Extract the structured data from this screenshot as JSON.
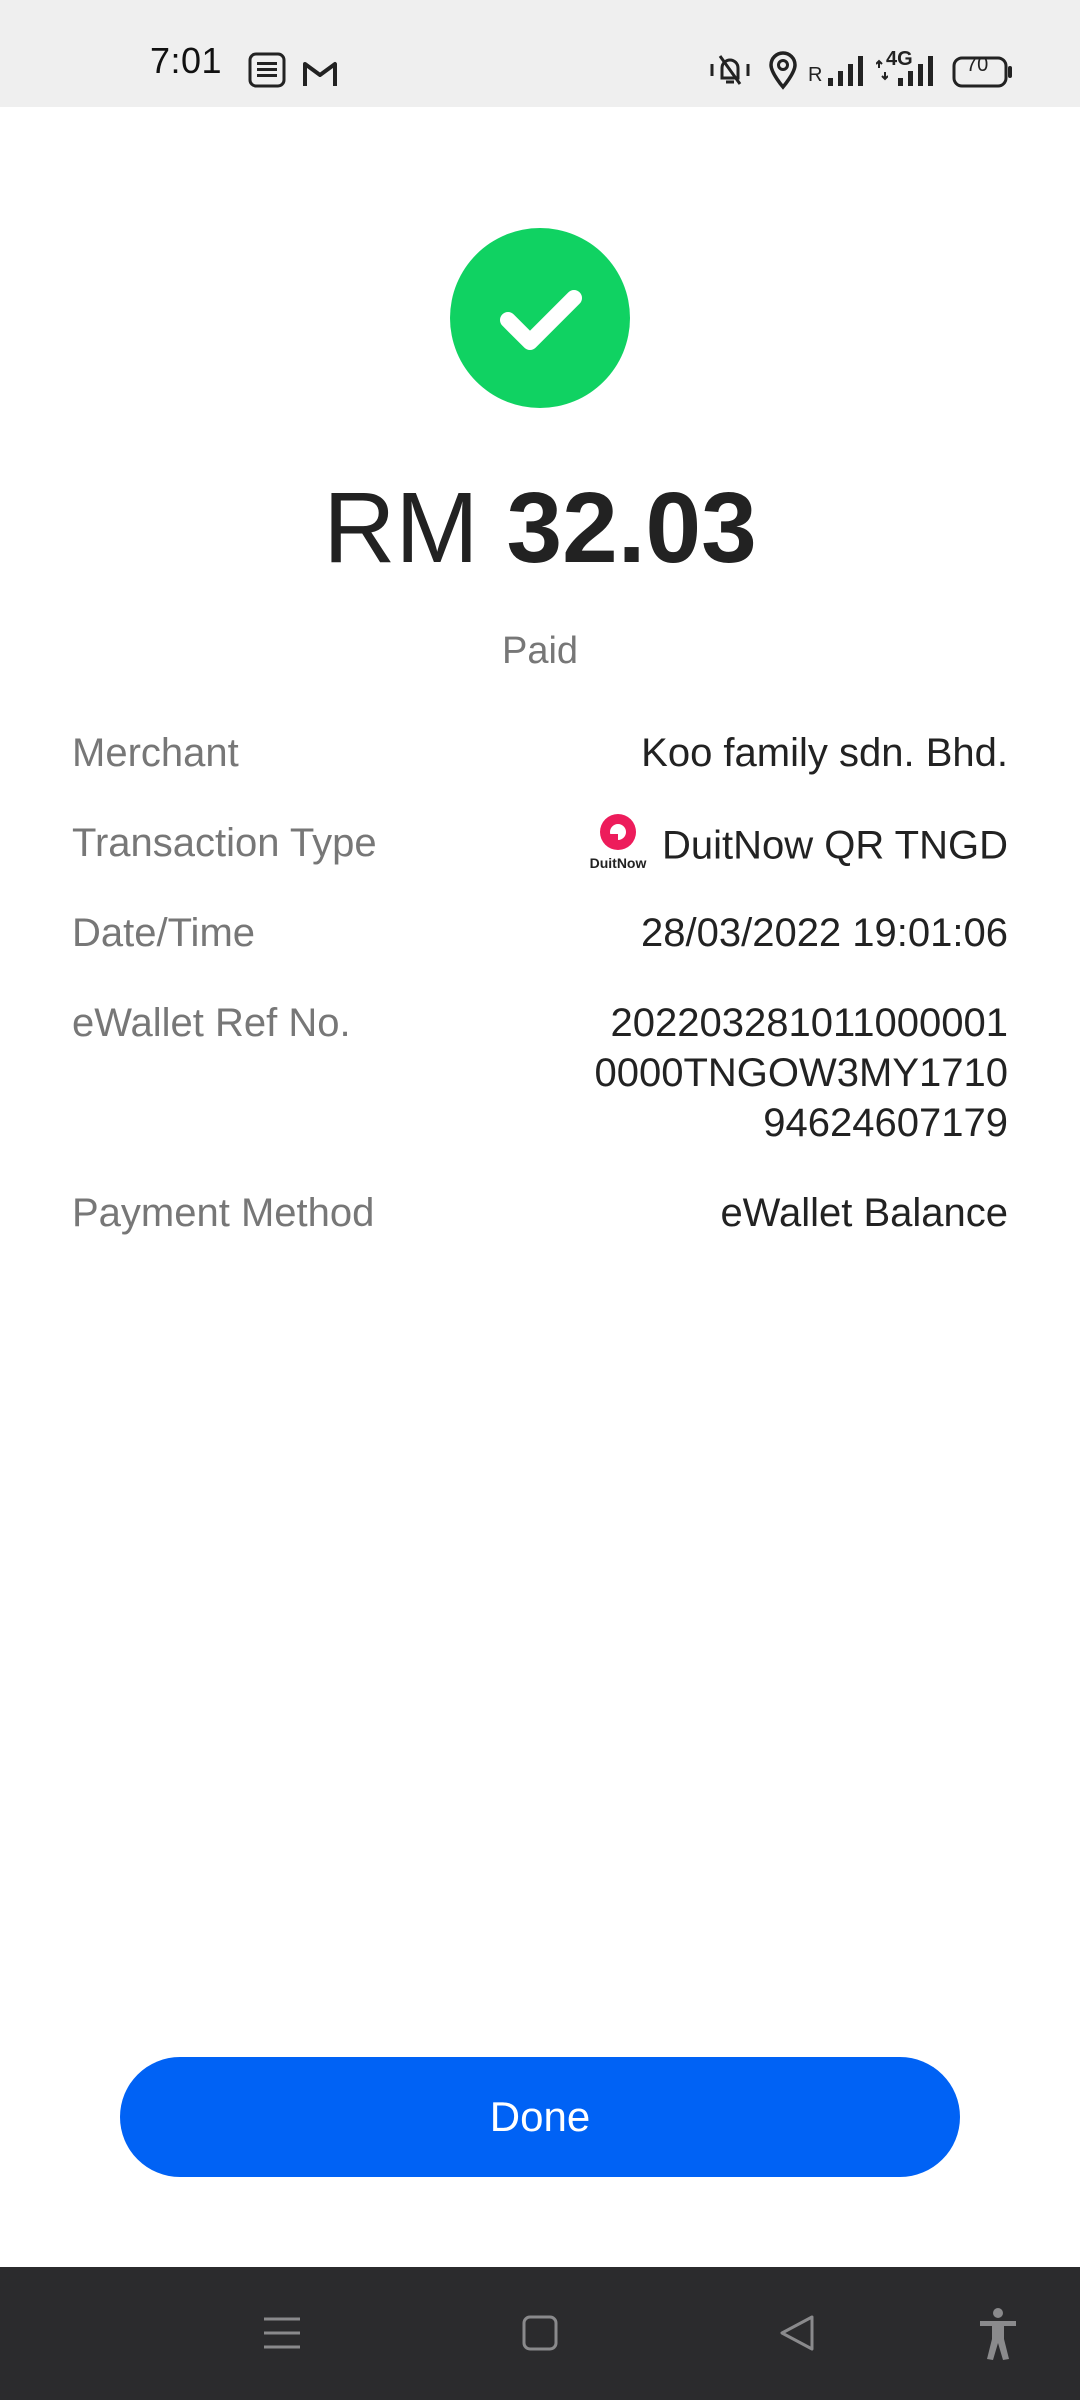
{
  "status_bar": {
    "time": "7:01",
    "battery": "70",
    "network": "4G",
    "roaming": "R"
  },
  "receipt": {
    "currency": "RM",
    "amount": "32.03",
    "status": "Paid"
  },
  "details": {
    "merchant_label": "Merchant",
    "merchant_value": "Koo family sdn. Bhd.",
    "type_label": "Transaction Type",
    "type_value": "DuitNow QR TNGD",
    "type_logo_text": "DuitNow",
    "date_label": "Date/Time",
    "date_value": "28/03/2022 19:01:06",
    "ref_label": "eWallet Ref No.",
    "ref_lines": [
      "202203281011000001",
      "0000TNGOW3MY1710",
      "94624607179"
    ],
    "method_label": "Payment Method",
    "method_value": "eWallet Balance"
  },
  "actions": {
    "done_label": "Done"
  },
  "colors": {
    "success": "#10d262",
    "primary": "#0062f5",
    "duitnow": "#ed1c5b"
  }
}
